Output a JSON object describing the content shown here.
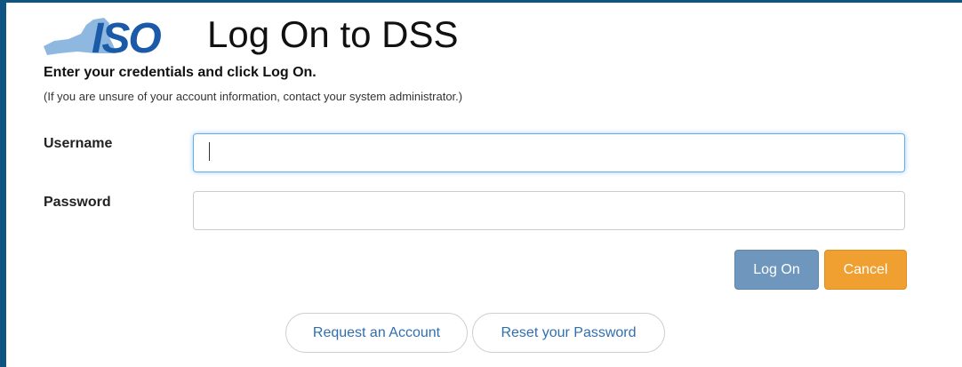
{
  "header": {
    "logo_text": "ISO",
    "title": "Log On to DSS"
  },
  "intro": {
    "subtitle": "Enter your credentials and click Log On.",
    "hint": "(If you are unsure of your account information, contact your system administrator.)"
  },
  "form": {
    "username_label": "Username",
    "username_value": "",
    "password_label": "Password",
    "password_value": ""
  },
  "actions": {
    "logon_label": "Log On",
    "cancel_label": "Cancel"
  },
  "links": {
    "request_account": "Request an Account",
    "reset_password": "Reset your Password"
  },
  "colors": {
    "frame": "#0f5583",
    "logo_blue": "#1a5aa8",
    "logo_map": "#8fb8e0",
    "logon_button": "#6f97bd",
    "cancel_button": "#f0a030",
    "link_text": "#2f6faf"
  }
}
